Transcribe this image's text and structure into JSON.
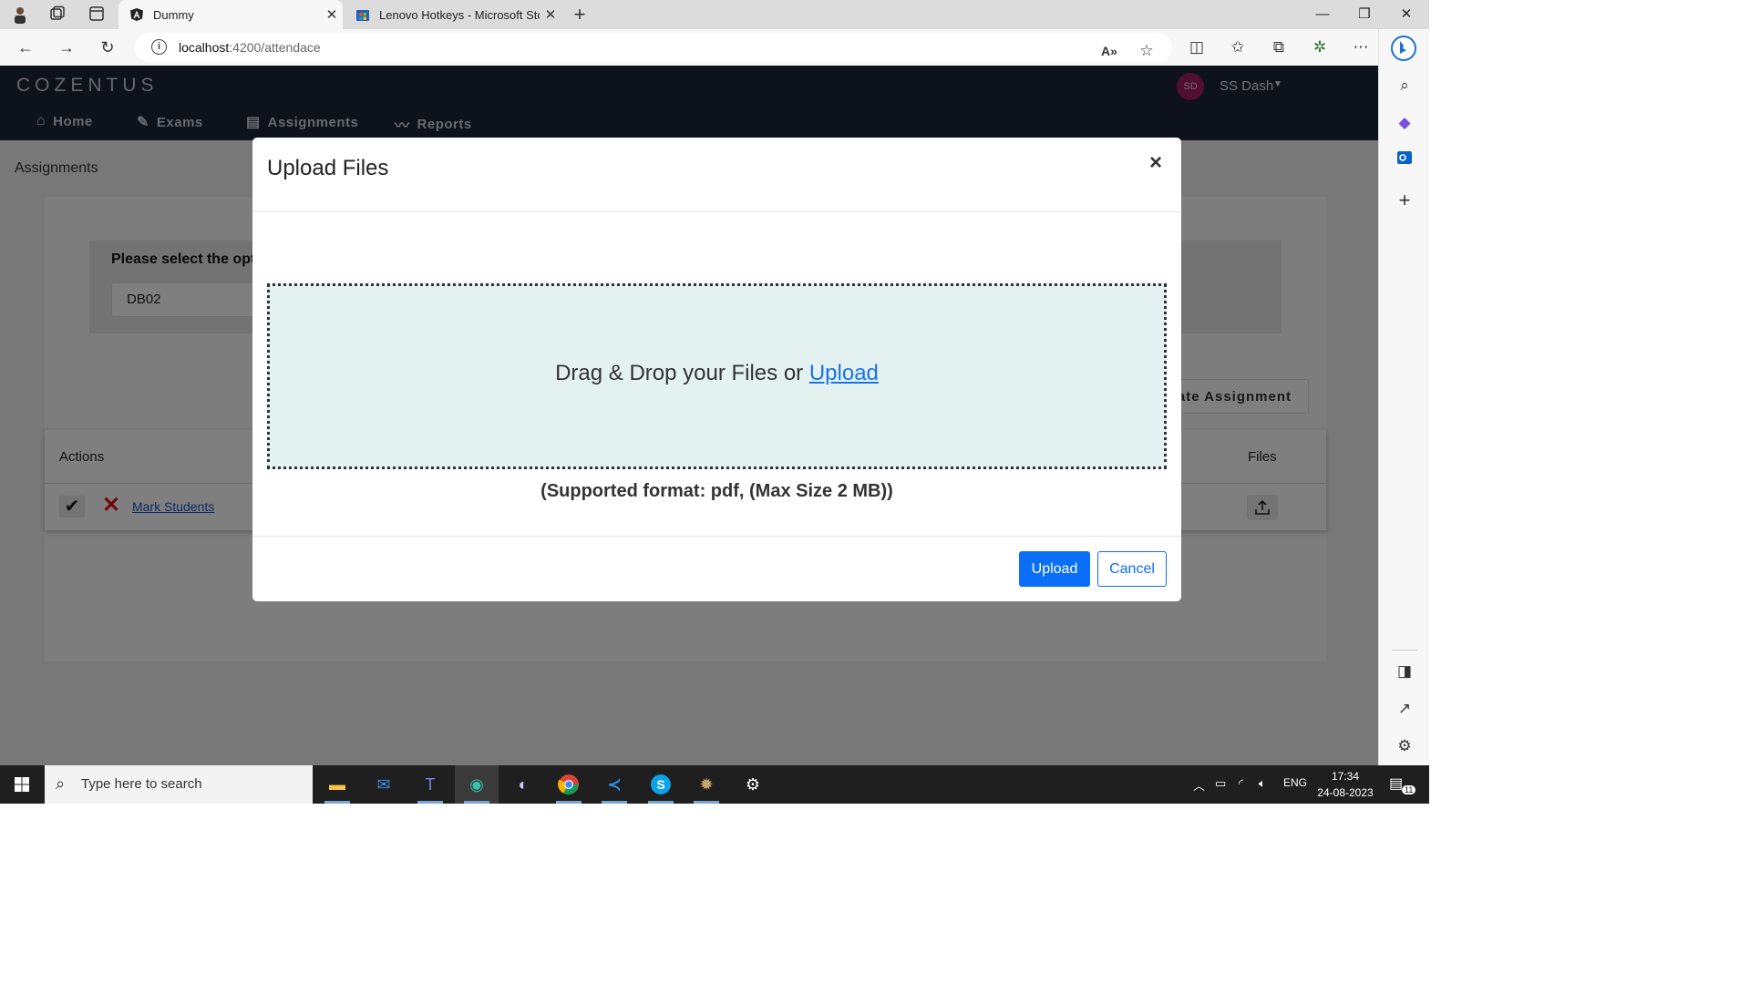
{
  "browser": {
    "tabs": [
      {
        "title": "Dummy",
        "active": true,
        "icon": "angular-icon"
      },
      {
        "title": "Lenovo Hotkeys - Microsoft Store",
        "active": false,
        "icon": "store-icon"
      }
    ],
    "url_host": "localhost",
    "url_rest": ":4200/attendace"
  },
  "app": {
    "logo": "COZENTUS",
    "user": {
      "initials": "SD",
      "name": "SS Dash"
    },
    "menu": [
      {
        "label": "Home",
        "icon": "home-icon"
      },
      {
        "label": "Exams",
        "icon": "exams-icon"
      },
      {
        "label": "Assignments",
        "icon": "document-icon"
      },
      {
        "label": "Reports",
        "icon": "chart-line-icon"
      }
    ],
    "page_heading": "Assignments",
    "option_label": "Please select the opt",
    "option_value": "DB02",
    "create_button": "ate Assignment",
    "table": {
      "headers": {
        "actions": "Actions",
        "files": "Files"
      },
      "row": {
        "mark_link": "Mark Students"
      }
    }
  },
  "modal": {
    "title": "Upload Files",
    "close": "×",
    "dropzone_text": "Drag & Drop your Files or ",
    "dropzone_link": "Upload",
    "supported_text": "(Supported format: pdf, (Max Size 2 MB))",
    "upload_button": "Upload",
    "cancel_button": "Cancel"
  },
  "taskbar": {
    "search_placeholder": "Type here to search",
    "language": "ENG",
    "time": "17:34",
    "date": "24-08-2023",
    "notification_count": "11"
  },
  "colors": {
    "header_bg": "#1a2537",
    "primary": "#0b6ef7",
    "dropzone_bg": "#e3f2f1",
    "avatar": "#a31a65"
  }
}
